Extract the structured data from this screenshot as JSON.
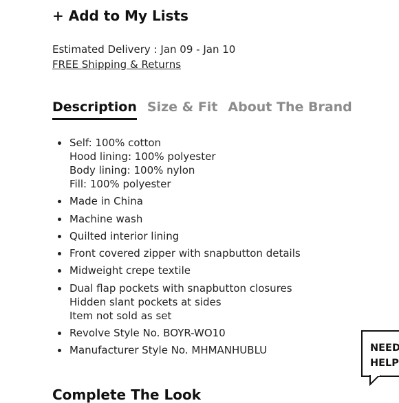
{
  "add_to_lists": "+ Add to My Lists",
  "delivery": {
    "estimate": "Estimated Delivery : Jan 09 - Jan 10",
    "shipping_link": "FREE Shipping & Returns"
  },
  "tabs": [
    {
      "label": "Description",
      "active": true
    },
    {
      "label": "Size & Fit",
      "active": false
    },
    {
      "label": "About The Brand",
      "active": false
    }
  ],
  "description": {
    "items": [
      {
        "lines": [
          "Self: 100% cotton",
          "Hood lining: 100% polyester",
          "Body lining: 100% nylon",
          "Fill: 100% polyester"
        ]
      },
      {
        "lines": [
          "Made in China"
        ]
      },
      {
        "lines": [
          "Machine wash"
        ]
      },
      {
        "lines": [
          "Quilted interior lining"
        ]
      },
      {
        "lines": [
          "Front covered zipper with snapbutton details"
        ]
      },
      {
        "lines": [
          "Midweight crepe textile"
        ]
      },
      {
        "lines": [
          "Dual flap pockets with snapbutton closures",
          "Hidden slant pockets at sides",
          "Item not sold as set"
        ]
      },
      {
        "lines": [
          "Revolve Style No. BOYR-WO10"
        ]
      },
      {
        "lines": [
          "Manufacturer Style No. MHMANHUBLU"
        ]
      }
    ]
  },
  "complete_look": "Complete The Look",
  "help": {
    "line1": "NEED",
    "line2": "HELP"
  }
}
